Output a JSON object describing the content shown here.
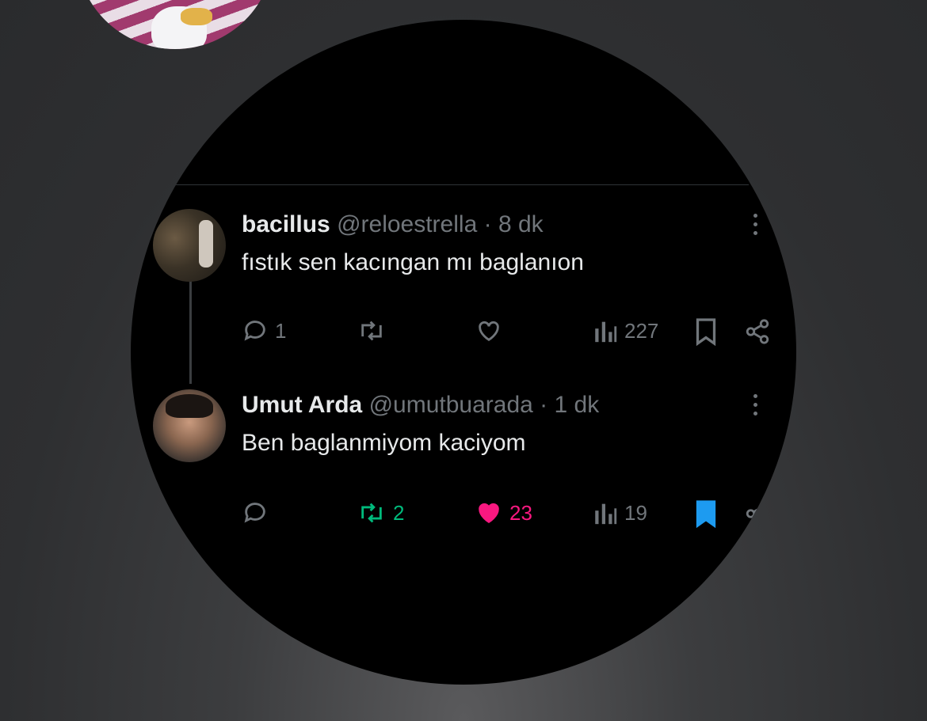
{
  "tweets": [
    {
      "name": "bacillus",
      "handle": "@reloestrella",
      "separator": "·",
      "time": "8 dk",
      "text": "fıstık sen kacıngan mı baglanıon",
      "replies": "1",
      "reposts": "",
      "likes": "",
      "views": "227",
      "liked": false,
      "reposted": false,
      "bookmarked": false
    },
    {
      "name": "Umut Arda",
      "handle": "@umutbuarada",
      "separator": "·",
      "time": "1 dk",
      "text": "Ben baglanmiyom kaciyom",
      "replies": "",
      "reposts": "2",
      "likes": "23",
      "views": "19",
      "liked": true,
      "reposted": true,
      "bookmarked": true
    }
  ],
  "colors": {
    "background": "#000000",
    "text": "#e7e9ea",
    "secondary": "#71767b",
    "repost_active": "#00ba7c",
    "like_active": "#f91880",
    "bookmark_active": "#1d9bf0"
  },
  "icons": [
    "reply-icon",
    "repost-icon",
    "like-icon",
    "views-icon",
    "bookmark-icon",
    "share-icon",
    "more-icon"
  ]
}
